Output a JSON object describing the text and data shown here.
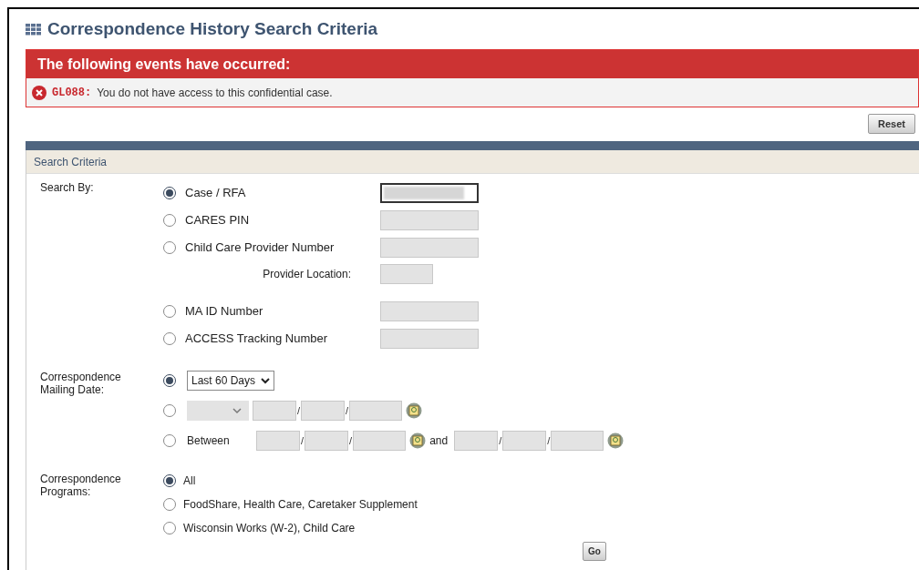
{
  "title": "Correspondence History Search Criteria",
  "error": {
    "heading": "The following events have occurred:",
    "code": "GL088:",
    "message": "You do not have access to this confidential case."
  },
  "reset_button": "Reset",
  "section_title": "Search Criteria",
  "search_by": {
    "label": "Search By:",
    "options": [
      {
        "kind": "option",
        "label": "Case / RFA",
        "selected": true
      },
      {
        "kind": "option",
        "label": "CARES PIN",
        "selected": false
      },
      {
        "kind": "option",
        "label": "Child Care Provider Number",
        "selected": false
      },
      {
        "kind": "sublabel",
        "label": "Provider Location:"
      },
      {
        "kind": "option",
        "label": "MA ID Number",
        "selected": false
      },
      {
        "kind": "option",
        "label": "ACCESS Tracking Number",
        "selected": false
      }
    ]
  },
  "mailing_date": {
    "label": "Correspondence Mailing Date:",
    "options": [
      {
        "kind": "preset",
        "selected": true,
        "value": "Last 60 Days"
      },
      {
        "kind": "relative",
        "selected": false,
        "dates": [
          {
            "separators": [
              "/",
              "/"
            ]
          }
        ]
      },
      {
        "kind": "between",
        "selected": false,
        "label": "Between",
        "joiner": "and",
        "dates": [
          {
            "separators": [
              "/",
              "/"
            ]
          },
          {
            "separators": [
              "/",
              "/"
            ]
          }
        ]
      }
    ]
  },
  "programs": {
    "label": "Correspondence Programs:",
    "options": [
      {
        "label": "All",
        "selected": true
      },
      {
        "label": "FoodShare, Health Care, Caretaker Supplement",
        "selected": false
      },
      {
        "label": "Wisconsin Works (W-2), Child Care",
        "selected": false
      }
    ]
  },
  "go_button": "Go"
}
